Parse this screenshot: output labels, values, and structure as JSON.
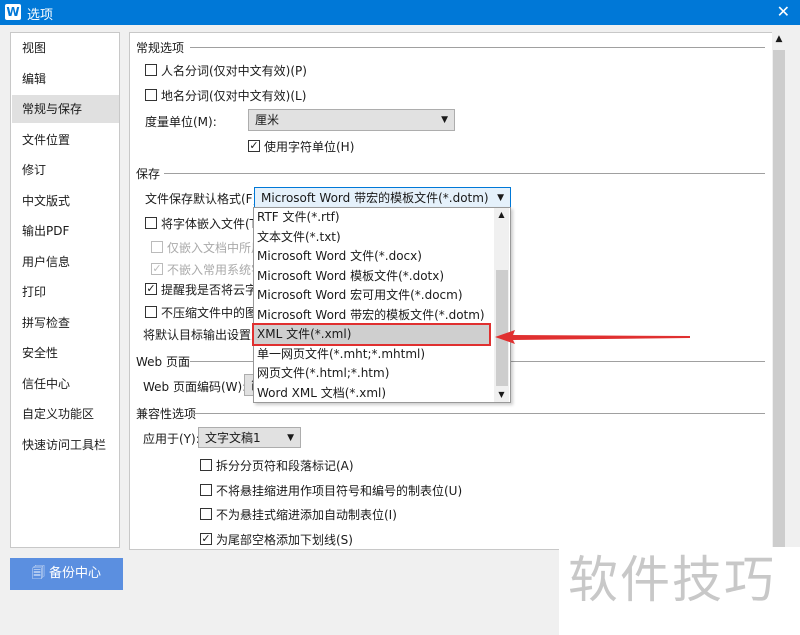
{
  "window": {
    "title": "选项",
    "logo": "W",
    "close_icon": "close-icon"
  },
  "sidebar": {
    "items": [
      {
        "label": "视图"
      },
      {
        "label": "编辑"
      },
      {
        "label": "常规与保存",
        "selected": true
      },
      {
        "label": "文件位置"
      },
      {
        "label": "修订"
      },
      {
        "label": "中文版式"
      },
      {
        "label": "输出PDF"
      },
      {
        "label": "用户信息"
      },
      {
        "label": "打印"
      },
      {
        "label": "拼写检查"
      },
      {
        "label": "安全性"
      },
      {
        "label": "信任中心"
      },
      {
        "label": "自定义功能区"
      },
      {
        "label": "快速访问工具栏"
      }
    ]
  },
  "general": {
    "legend": "常规选项",
    "person_name": {
      "label": "人名分词(仅对中文有效)(P)",
      "checked": false
    },
    "place_name": {
      "label": "地名分词(仅对中文有效)(L)",
      "checked": false
    },
    "unit_label": "度量单位(M):",
    "unit_value": "厘米",
    "char_unit": {
      "label": "使用字符单位(H)",
      "checked": true
    }
  },
  "save": {
    "legend": "保存",
    "format_label": "文件保存默认格式(F):",
    "format_value": "Microsoft Word 带宏的模板文件(*.dotm)",
    "embed_fonts": {
      "label": "将字体嵌入文件(T)",
      "checked": false
    },
    "embed_used": {
      "label": "仅嵌入文档中所用",
      "checked": false,
      "disabled": true
    },
    "no_embed_common": {
      "label": "不嵌入常用系统字",
      "checked": true,
      "disabled": true
    },
    "remind_cloud": {
      "label": "提醒我是否将云字体",
      "checked": true
    },
    "no_compress": {
      "label": "不压缩文件中的图像",
      "checked": false
    },
    "default_target": "将默认目标输出设置为"
  },
  "dropdown": {
    "options": [
      "RTF 文件(*.rtf)",
      "文本文件(*.txt)",
      "Microsoft Word 文件(*.docx)",
      "Microsoft Word 模板文件(*.dotx)",
      "Microsoft Word 宏可用文件(*.docm)",
      "Microsoft Word 带宏的模板文件(*.dotm)",
      "XML 文件(*.xml)",
      "单一网页文件(*.mht;*.mhtml)",
      "网页文件(*.html;*.htm)",
      "Word XML 文档(*.xml)"
    ],
    "highlighted": "XML 文件(*.xml)",
    "annotation_color": "#e03030"
  },
  "web": {
    "legend": "Web 页面",
    "encoding_label": "Web 页面编码(W):",
    "encoding_value": "简"
  },
  "compat": {
    "legend": "兼容性选项",
    "apply_label": "应用于(Y):",
    "apply_value": "文字文稿1",
    "options": [
      {
        "label": "拆分分页符和段落标记(A)",
        "checked": false
      },
      {
        "label": "不将悬挂缩进用作项目符号和编号的制表位(U)",
        "checked": false
      },
      {
        "label": "不为悬挂式缩进添加自动制表位(I)",
        "checked": false
      },
      {
        "label": "为尾部空格添加下划线(S)",
        "checked": true
      }
    ]
  },
  "footer": {
    "backup_label": "备份中心"
  },
  "watermark": "软件技巧",
  "colors": {
    "titlebar": "#0078d7",
    "backup": "#5b8fe0"
  }
}
